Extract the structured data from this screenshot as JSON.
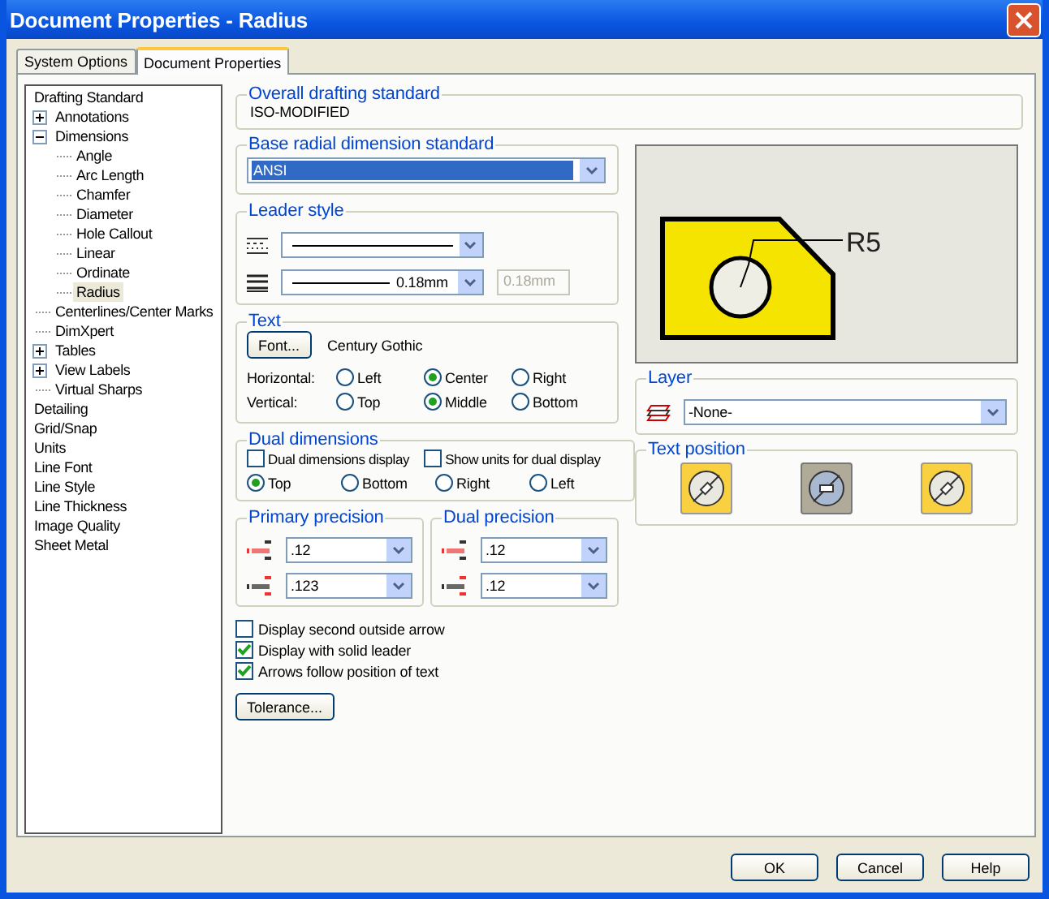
{
  "window": {
    "title": "Document Properties - Radius"
  },
  "tabs": [
    {
      "label": "System Options",
      "selected": false
    },
    {
      "label": "Document Properties",
      "selected": true
    }
  ],
  "tree": [
    {
      "label": "Drafting Standard",
      "selected": false,
      "children": [
        {
          "label": "Annotations",
          "selected": false,
          "expanded": false
        },
        {
          "label": "Dimensions",
          "selected": false,
          "expanded": true,
          "children": [
            {
              "label": "Angle",
              "selected": false
            },
            {
              "label": "Arc Length",
              "selected": false
            },
            {
              "label": "Chamfer",
              "selected": false
            },
            {
              "label": "Diameter",
              "selected": false
            },
            {
              "label": "Hole Callout",
              "selected": false
            },
            {
              "label": "Linear",
              "selected": false
            },
            {
              "label": "Ordinate",
              "selected": false
            },
            {
              "label": "Radius",
              "selected": true
            }
          ]
        },
        {
          "label": "Centerlines/Center Marks",
          "selected": false
        },
        {
          "label": "DimXpert",
          "selected": false
        },
        {
          "label": "Tables",
          "selected": false,
          "expanded": false
        },
        {
          "label": "View Labels",
          "selected": false,
          "expanded": false
        },
        {
          "label": "Virtual Sharps",
          "selected": false
        }
      ]
    },
    {
      "label": "Detailing",
      "selected": false
    },
    {
      "label": "Grid/Snap",
      "selected": false
    },
    {
      "label": "Units",
      "selected": false
    },
    {
      "label": "Line Font",
      "selected": false
    },
    {
      "label": "Line Style",
      "selected": false
    },
    {
      "label": "Line Thickness",
      "selected": false
    },
    {
      "label": "Image Quality",
      "selected": false
    },
    {
      "label": "Sheet Metal",
      "selected": false
    }
  ],
  "overall_standard": {
    "label": "Overall drafting standard",
    "value": "ISO-MODIFIED"
  },
  "base_radial": {
    "label": "Base radial dimension standard",
    "value": "ANSI"
  },
  "leader_style": {
    "label": "Leader style",
    "thickness": "0.18mm",
    "custom_thickness": {
      "value": "0.18mm",
      "disabled": true
    }
  },
  "text": {
    "label": "Text",
    "font_button": "Font...",
    "font_name": "Century Gothic",
    "rows": [
      {
        "label": "Horizontal:",
        "options": [
          {
            "label": "Left",
            "selected": false
          },
          {
            "label": "Center",
            "selected": true
          },
          {
            "label": "Right",
            "selected": false
          }
        ]
      },
      {
        "label": "Vertical:",
        "options": [
          {
            "label": "Top",
            "selected": false
          },
          {
            "label": "Middle",
            "selected": true
          },
          {
            "label": "Bottom",
            "selected": false
          }
        ]
      }
    ]
  },
  "dual_dimensions": {
    "label": "Dual dimensions",
    "checks": [
      {
        "label": "Dual dimensions display",
        "checked": false
      },
      {
        "label": "Show units for dual display",
        "checked": false
      }
    ],
    "options": [
      {
        "label": "Top",
        "selected": true
      },
      {
        "label": "Bottom",
        "selected": false
      },
      {
        "label": "Right",
        "selected": false
      },
      {
        "label": "Left",
        "selected": false
      }
    ]
  },
  "precision": [
    {
      "label": "Primary precision",
      "values": [
        ".12",
        ".123"
      ]
    },
    {
      "label": "Dual precision",
      "values": [
        ".12",
        ".12"
      ]
    }
  ],
  "options": [
    {
      "label": "Display second outside arrow",
      "checked": false
    },
    {
      "label": "Display with solid leader",
      "checked": true
    },
    {
      "label": "Arrows follow position of text",
      "checked": true
    }
  ],
  "tolerance_button": "Tolerance...",
  "preview": {
    "dimension_label": "R5"
  },
  "layer": {
    "label": "Layer",
    "value": "-None-"
  },
  "text_position": {
    "label": "Text position",
    "buttons": [
      {
        "selected": false
      },
      {
        "selected": true
      },
      {
        "selected": false
      }
    ]
  },
  "buttons": [
    "OK",
    "Cancel",
    "Help"
  ]
}
